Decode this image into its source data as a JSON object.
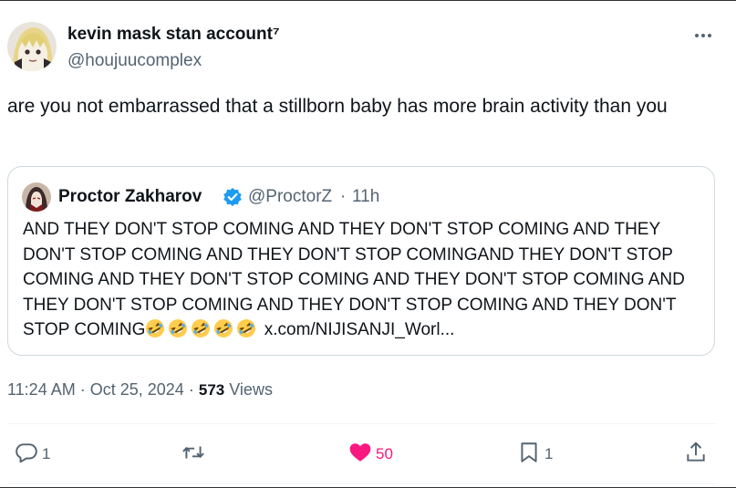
{
  "author": {
    "display_name": "kevin mask stan account⁷",
    "handle": "@houjuucomplex"
  },
  "tweet": {
    "text": "are you not embarrassed that a stillborn baby has more brain activity than you"
  },
  "quote": {
    "display_name": "Proctor Zakharov",
    "handle": "@ProctorZ",
    "separator": "·",
    "time": "11h",
    "text": "AND THEY DON'T STOP COMING AND THEY DON'T STOP COMING AND THEY DON'T STOP COMING AND THEY DON'T STOP COMINGAND THEY DON'T STOP COMING AND THEY DON'T STOP COMING AND THEY DON'T STOP COMING AND THEY DON'T STOP COMING AND THEY DON'T STOP COMING AND THEY DON'T STOP COMING",
    "link": "x.com/NIJISANJI_Worl...",
    "emoji_count": 5,
    "emoji_name": "rolling-on-floor-laughing"
  },
  "meta": {
    "time": "11:24 AM",
    "sep1": "·",
    "date": "Oct 25, 2024",
    "sep2": "·",
    "views_count": "573",
    "views_label": "Views"
  },
  "actions": {
    "replies": "1",
    "retweets": "",
    "likes": "50",
    "bookmarks": "1"
  },
  "colors": {
    "like": "#f91880",
    "verified": "#1d9bf0",
    "secondary": "#536471"
  },
  "icons": [
    "more-icon",
    "verified-badge-icon",
    "reply-icon",
    "retweet-icon",
    "like-heart-icon",
    "bookmark-icon",
    "share-icon"
  ]
}
